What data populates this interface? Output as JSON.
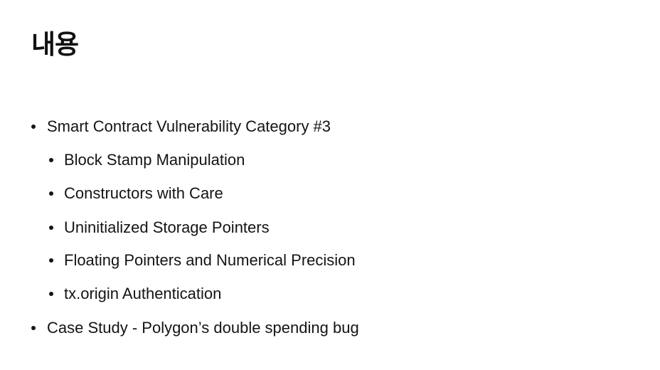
{
  "slide": {
    "title": "내용",
    "bullets": [
      {
        "text": "Smart Contract Vulnerability Category #3",
        "level": 1
      },
      {
        "text": "Block Stamp Manipulation",
        "level": 2
      },
      {
        "text": "Constructors with Care",
        "level": 2
      },
      {
        "text": "Uninitialized Storage Pointers",
        "level": 2
      },
      {
        "text": "Floating Pointers and Numerical Precision",
        "level": 2
      },
      {
        "text": "tx.origin Authentication",
        "level": 2
      },
      {
        "text": "Case Study - Polygon’s double spending bug",
        "level": 1
      }
    ]
  }
}
